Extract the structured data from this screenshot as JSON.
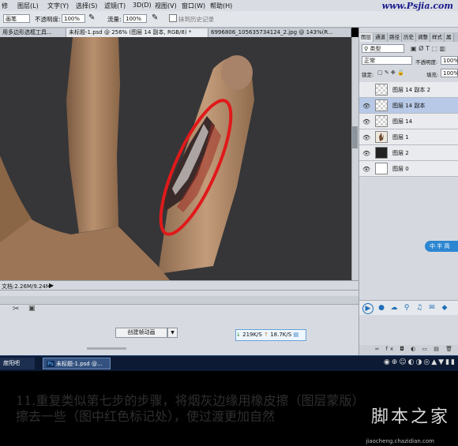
{
  "menubar": {
    "items": [
      "修",
      "图层(L)",
      "文字(Y)",
      "选择(S)",
      "滤镜(T)",
      "3D(D)",
      "视图(V)",
      "窗口(W)",
      "帮助(H)"
    ],
    "watermark": "www.Psjia.com"
  },
  "options": {
    "mode_value": "画笔",
    "opacity_label": "不透明度:",
    "opacity_value": "100%",
    "flow_label": "流量:",
    "flow_value": "100%",
    "history_label": "抹到历史记录"
  },
  "tabs": [
    {
      "label": "用多边形选框工具..."
    },
    {
      "label": "未标题-1.psd @ 256% (图层 14 副本, RGB/8) *"
    },
    {
      "label": "6996806_105635734124_2.jpg @ 143%(R..."
    }
  ],
  "status": {
    "doc": "文档:2.26M/9.24M"
  },
  "timeline": {
    "create_label": "创建帧动画",
    "dropdown_icon": "chevron-down-icon"
  },
  "network": {
    "upload": "219K/S",
    "download": "18.7K/S"
  },
  "panel": {
    "tabs": [
      "图层",
      "通道",
      "路径",
      "历史",
      "调整",
      "样式",
      "属"
    ],
    "kind_label": "类型",
    "blend_mode": "正常",
    "opacity_label": "不透明度:",
    "opacity_value": "100%",
    "lock_label": "锁定:",
    "fill_label": "填充:",
    "fill_value": "100%",
    "layers": [
      {
        "name": "图层 14 副本 2",
        "visible": false,
        "selected": false,
        "thumb": "checker"
      },
      {
        "name": "图层 14 副本",
        "visible": true,
        "selected": true,
        "thumb": "checker"
      },
      {
        "name": "图层 14",
        "visible": true,
        "selected": false,
        "thumb": "checker"
      },
      {
        "name": "图层 1",
        "visible": true,
        "selected": false,
        "thumb": "hand"
      },
      {
        "name": "图层 2",
        "visible": true,
        "selected": false,
        "thumb": "dark"
      },
      {
        "name": "图层 0",
        "visible": true,
        "selected": false,
        "thumb": "white"
      }
    ],
    "side_badge": "中 半 简"
  },
  "taskbar": {
    "items": [
      "度阳吧",
      "未标题-1.psd @..."
    ],
    "clock": "..."
  },
  "caption": {
    "line1": "11.重复类似第七步的步骤，将烟灰边缘用橡皮擦（图层蒙版）",
    "line2": "擦去一些（图中红色标记处），使过渡更加自然",
    "logo": "脚本之家",
    "url": "jiaocheng.chazidian.com"
  },
  "colors": {
    "accent": "#2d86d1",
    "highlight_ring": "#e0191a"
  }
}
